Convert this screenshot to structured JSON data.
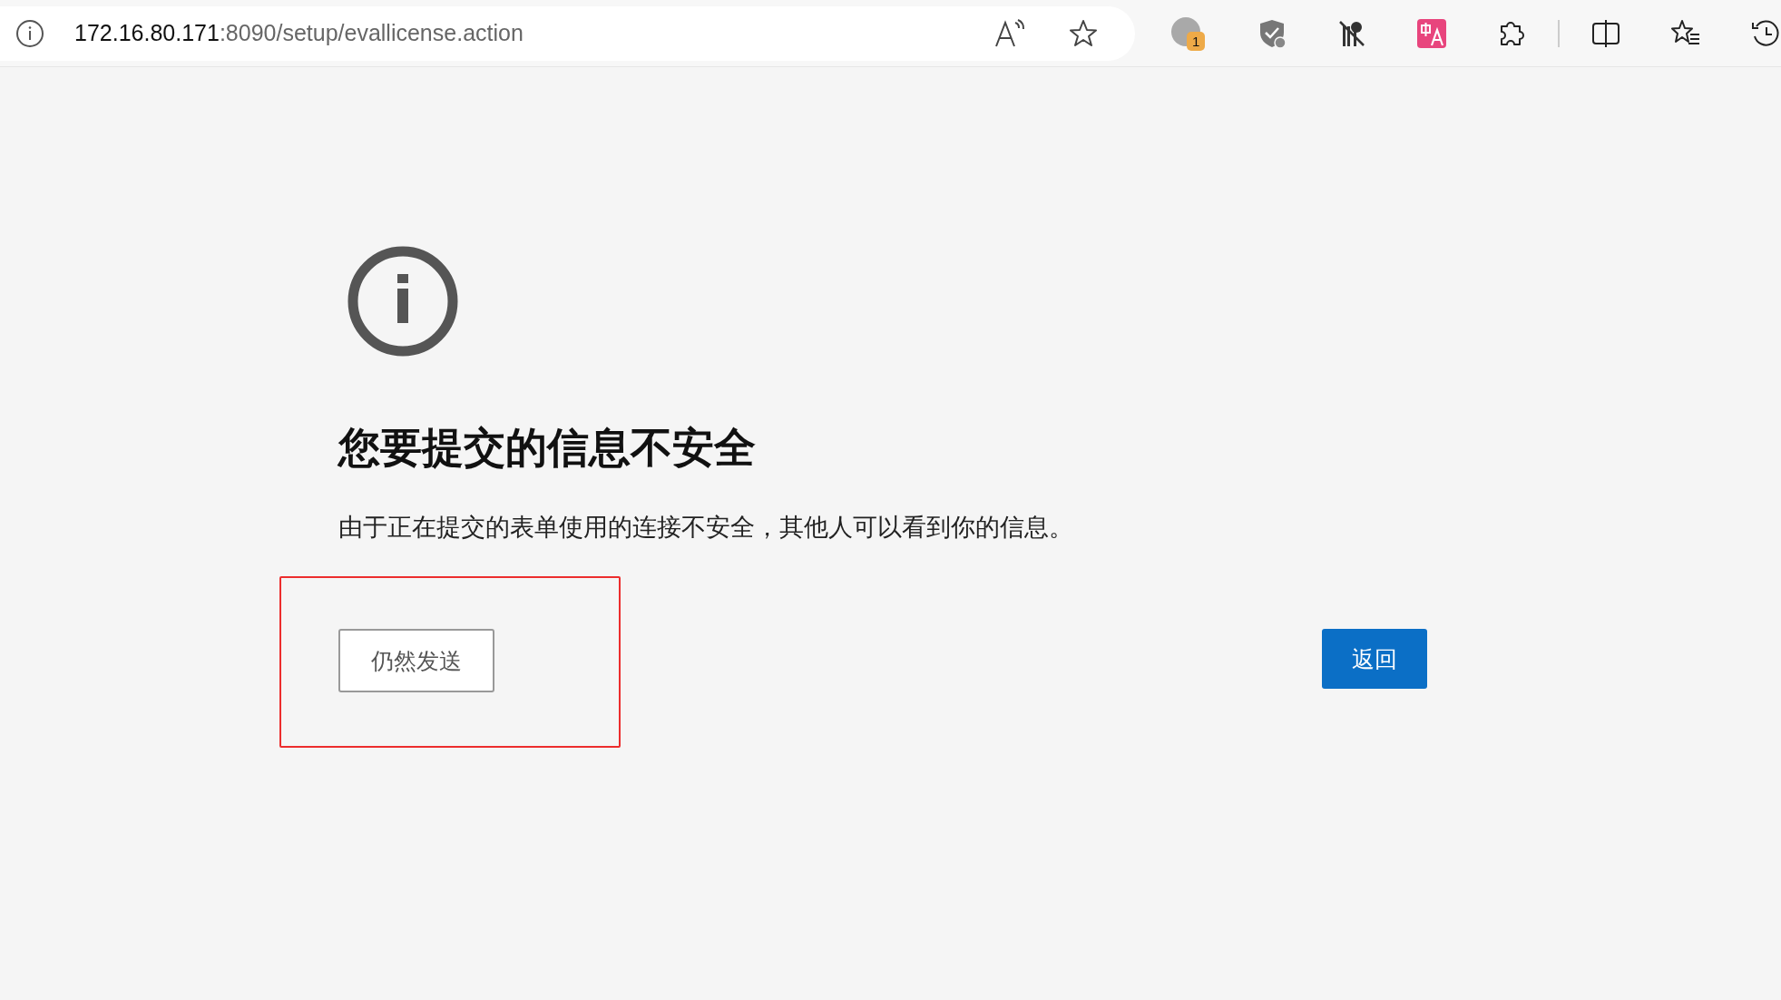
{
  "address_bar": {
    "host": "172.16.80.171",
    "path": ":8090/setup/evallicense.action"
  },
  "toolbar": {
    "profile_badge": "1"
  },
  "page": {
    "heading": "您要提交的信息不安全",
    "message": "由于正在提交的表单使用的连接不安全，其他人可以看到你的信息。",
    "buttons": [
      {
        "label": "仍然发送",
        "kind": "secondary",
        "highlighted": true
      },
      {
        "label": "返回",
        "kind": "primary",
        "highlighted": false
      }
    ]
  }
}
